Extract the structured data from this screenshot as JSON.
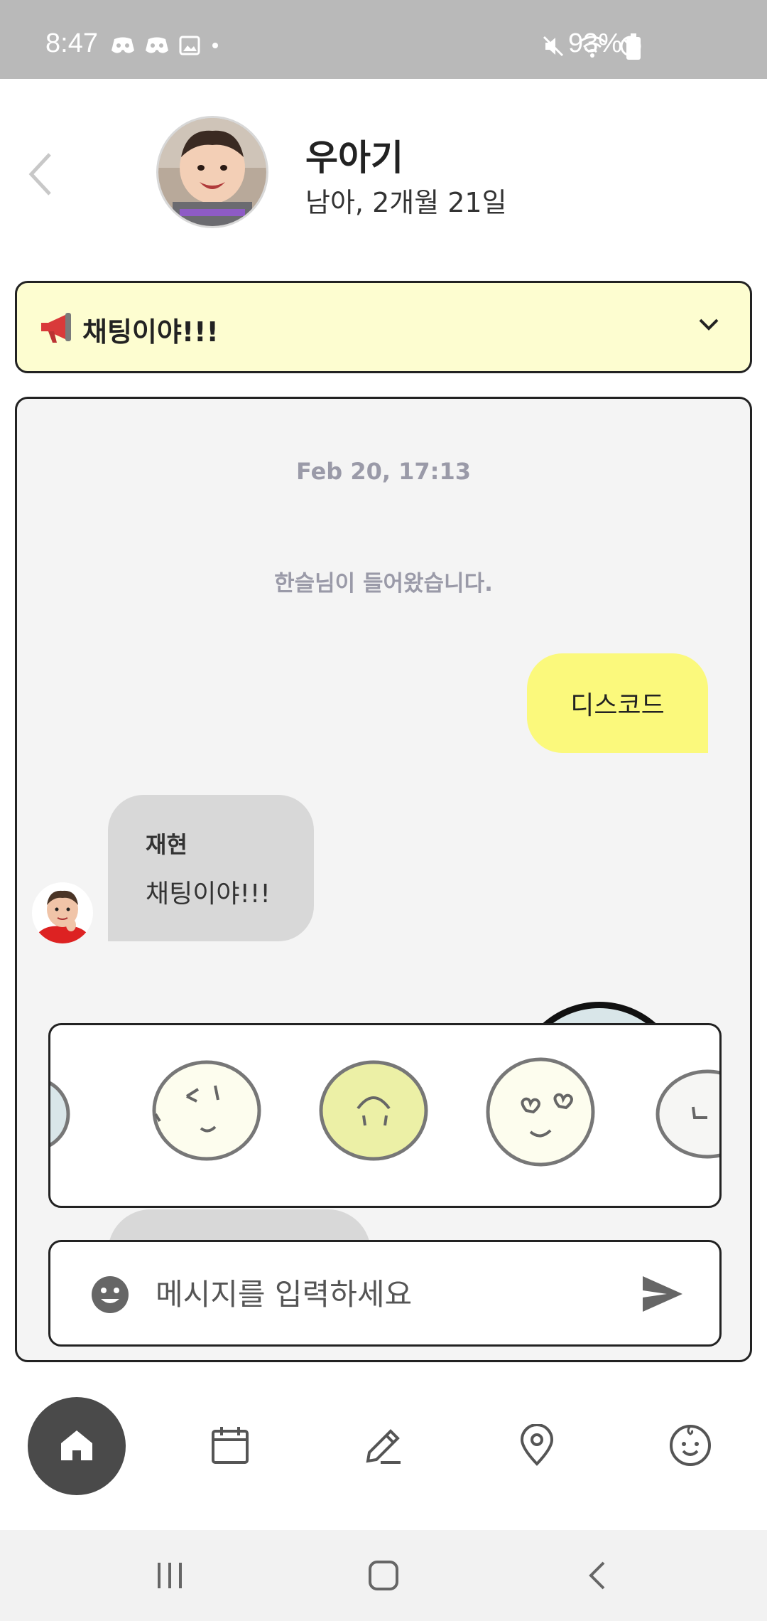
{
  "status_bar": {
    "time": "8:47",
    "battery": "93%"
  },
  "header": {
    "name": "우아기",
    "info": "남아, 2개월 21일"
  },
  "notice": {
    "text": "채팅이야!!!"
  },
  "chat": {
    "date": "Feb 20, 17:13",
    "system_message": "한슬님이 들어왔습니다.",
    "my_message": "디스코드",
    "other_sender": "재현",
    "other_message": "채팅이야!!!"
  },
  "input": {
    "placeholder": "메시지를 입력하세요"
  },
  "colors": {
    "notice_bg": "#fdfdd0",
    "my_bubble": "#fbf97c",
    "other_bubble": "#d8d8d8",
    "nav_active": "#4a4a4a"
  },
  "icons": {
    "nav": [
      "home-icon",
      "calendar-icon",
      "pencil-icon",
      "location-pin-icon",
      "baby-face-icon"
    ]
  }
}
